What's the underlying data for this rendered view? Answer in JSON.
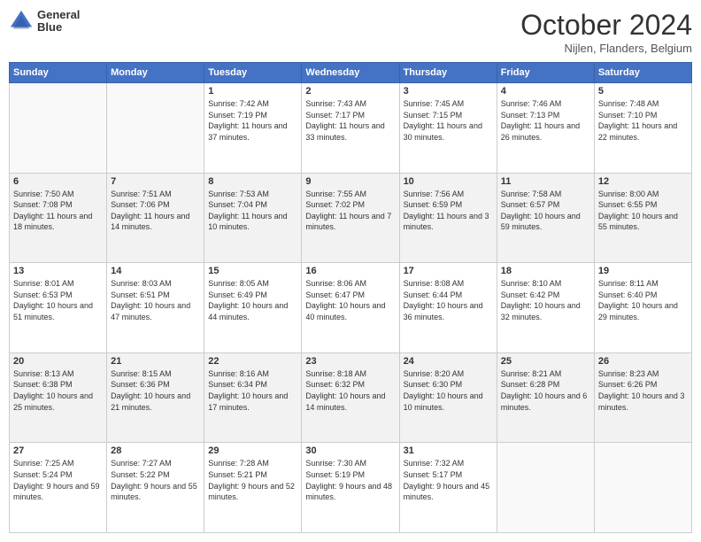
{
  "header": {
    "logo_line1": "General",
    "logo_line2": "Blue",
    "month_title": "October 2024",
    "location": "Nijlen, Flanders, Belgium"
  },
  "days_of_week": [
    "Sunday",
    "Monday",
    "Tuesday",
    "Wednesday",
    "Thursday",
    "Friday",
    "Saturday"
  ],
  "weeks": [
    [
      {
        "day": "",
        "sunrise": "",
        "sunset": "",
        "daylight": ""
      },
      {
        "day": "",
        "sunrise": "",
        "sunset": "",
        "daylight": ""
      },
      {
        "day": "1",
        "sunrise": "Sunrise: 7:42 AM",
        "sunset": "Sunset: 7:19 PM",
        "daylight": "Daylight: 11 hours and 37 minutes."
      },
      {
        "day": "2",
        "sunrise": "Sunrise: 7:43 AM",
        "sunset": "Sunset: 7:17 PM",
        "daylight": "Daylight: 11 hours and 33 minutes."
      },
      {
        "day": "3",
        "sunrise": "Sunrise: 7:45 AM",
        "sunset": "Sunset: 7:15 PM",
        "daylight": "Daylight: 11 hours and 30 minutes."
      },
      {
        "day": "4",
        "sunrise": "Sunrise: 7:46 AM",
        "sunset": "Sunset: 7:13 PM",
        "daylight": "Daylight: 11 hours and 26 minutes."
      },
      {
        "day": "5",
        "sunrise": "Sunrise: 7:48 AM",
        "sunset": "Sunset: 7:10 PM",
        "daylight": "Daylight: 11 hours and 22 minutes."
      }
    ],
    [
      {
        "day": "6",
        "sunrise": "Sunrise: 7:50 AM",
        "sunset": "Sunset: 7:08 PM",
        "daylight": "Daylight: 11 hours and 18 minutes."
      },
      {
        "day": "7",
        "sunrise": "Sunrise: 7:51 AM",
        "sunset": "Sunset: 7:06 PM",
        "daylight": "Daylight: 11 hours and 14 minutes."
      },
      {
        "day": "8",
        "sunrise": "Sunrise: 7:53 AM",
        "sunset": "Sunset: 7:04 PM",
        "daylight": "Daylight: 11 hours and 10 minutes."
      },
      {
        "day": "9",
        "sunrise": "Sunrise: 7:55 AM",
        "sunset": "Sunset: 7:02 PM",
        "daylight": "Daylight: 11 hours and 7 minutes."
      },
      {
        "day": "10",
        "sunrise": "Sunrise: 7:56 AM",
        "sunset": "Sunset: 6:59 PM",
        "daylight": "Daylight: 11 hours and 3 minutes."
      },
      {
        "day": "11",
        "sunrise": "Sunrise: 7:58 AM",
        "sunset": "Sunset: 6:57 PM",
        "daylight": "Daylight: 10 hours and 59 minutes."
      },
      {
        "day": "12",
        "sunrise": "Sunrise: 8:00 AM",
        "sunset": "Sunset: 6:55 PM",
        "daylight": "Daylight: 10 hours and 55 minutes."
      }
    ],
    [
      {
        "day": "13",
        "sunrise": "Sunrise: 8:01 AM",
        "sunset": "Sunset: 6:53 PM",
        "daylight": "Daylight: 10 hours and 51 minutes."
      },
      {
        "day": "14",
        "sunrise": "Sunrise: 8:03 AM",
        "sunset": "Sunset: 6:51 PM",
        "daylight": "Daylight: 10 hours and 47 minutes."
      },
      {
        "day": "15",
        "sunrise": "Sunrise: 8:05 AM",
        "sunset": "Sunset: 6:49 PM",
        "daylight": "Daylight: 10 hours and 44 minutes."
      },
      {
        "day": "16",
        "sunrise": "Sunrise: 8:06 AM",
        "sunset": "Sunset: 6:47 PM",
        "daylight": "Daylight: 10 hours and 40 minutes."
      },
      {
        "day": "17",
        "sunrise": "Sunrise: 8:08 AM",
        "sunset": "Sunset: 6:44 PM",
        "daylight": "Daylight: 10 hours and 36 minutes."
      },
      {
        "day": "18",
        "sunrise": "Sunrise: 8:10 AM",
        "sunset": "Sunset: 6:42 PM",
        "daylight": "Daylight: 10 hours and 32 minutes."
      },
      {
        "day": "19",
        "sunrise": "Sunrise: 8:11 AM",
        "sunset": "Sunset: 6:40 PM",
        "daylight": "Daylight: 10 hours and 29 minutes."
      }
    ],
    [
      {
        "day": "20",
        "sunrise": "Sunrise: 8:13 AM",
        "sunset": "Sunset: 6:38 PM",
        "daylight": "Daylight: 10 hours and 25 minutes."
      },
      {
        "day": "21",
        "sunrise": "Sunrise: 8:15 AM",
        "sunset": "Sunset: 6:36 PM",
        "daylight": "Daylight: 10 hours and 21 minutes."
      },
      {
        "day": "22",
        "sunrise": "Sunrise: 8:16 AM",
        "sunset": "Sunset: 6:34 PM",
        "daylight": "Daylight: 10 hours and 17 minutes."
      },
      {
        "day": "23",
        "sunrise": "Sunrise: 8:18 AM",
        "sunset": "Sunset: 6:32 PM",
        "daylight": "Daylight: 10 hours and 14 minutes."
      },
      {
        "day": "24",
        "sunrise": "Sunrise: 8:20 AM",
        "sunset": "Sunset: 6:30 PM",
        "daylight": "Daylight: 10 hours and 10 minutes."
      },
      {
        "day": "25",
        "sunrise": "Sunrise: 8:21 AM",
        "sunset": "Sunset: 6:28 PM",
        "daylight": "Daylight: 10 hours and 6 minutes."
      },
      {
        "day": "26",
        "sunrise": "Sunrise: 8:23 AM",
        "sunset": "Sunset: 6:26 PM",
        "daylight": "Daylight: 10 hours and 3 minutes."
      }
    ],
    [
      {
        "day": "27",
        "sunrise": "Sunrise: 7:25 AM",
        "sunset": "Sunset: 5:24 PM",
        "daylight": "Daylight: 9 hours and 59 minutes."
      },
      {
        "day": "28",
        "sunrise": "Sunrise: 7:27 AM",
        "sunset": "Sunset: 5:22 PM",
        "daylight": "Daylight: 9 hours and 55 minutes."
      },
      {
        "day": "29",
        "sunrise": "Sunrise: 7:28 AM",
        "sunset": "Sunset: 5:21 PM",
        "daylight": "Daylight: 9 hours and 52 minutes."
      },
      {
        "day": "30",
        "sunrise": "Sunrise: 7:30 AM",
        "sunset": "Sunset: 5:19 PM",
        "daylight": "Daylight: 9 hours and 48 minutes."
      },
      {
        "day": "31",
        "sunrise": "Sunrise: 7:32 AM",
        "sunset": "Sunset: 5:17 PM",
        "daylight": "Daylight: 9 hours and 45 minutes."
      },
      {
        "day": "",
        "sunrise": "",
        "sunset": "",
        "daylight": ""
      },
      {
        "day": "",
        "sunrise": "",
        "sunset": "",
        "daylight": ""
      }
    ]
  ]
}
